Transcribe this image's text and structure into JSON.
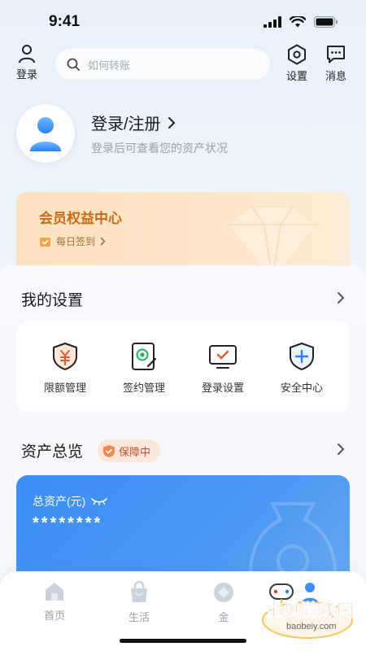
{
  "status": {
    "time": "9:41"
  },
  "nav": {
    "login_label": "登录",
    "search_placeholder": "如何转账",
    "settings_label": "设置",
    "messages_label": "消息"
  },
  "profile": {
    "title": "登录/注册",
    "subtitle": "登录后可查看您的资产状况"
  },
  "member": {
    "title": "会员权益中心",
    "checkin": "每日签到"
  },
  "settings_section": {
    "title": "我的设置",
    "items": [
      {
        "label": "限额管理",
        "icon": "yuan-shield-icon"
      },
      {
        "label": "签约管理",
        "icon": "contract-icon"
      },
      {
        "label": "登录设置",
        "icon": "monitor-check-icon"
      },
      {
        "label": "安全中心",
        "icon": "shield-plus-icon"
      }
    ]
  },
  "assets": {
    "title": "资产总览",
    "badge": "保障中",
    "total_label": "总资产(元)",
    "total_value": "********"
  },
  "tabbar": {
    "items": [
      {
        "label": "首页"
      },
      {
        "label": "生活"
      },
      {
        "label": "金"
      },
      {
        "label": ""
      }
    ]
  },
  "watermark": {
    "brand": "宝贝游戏网",
    "url": "baobeiy.com"
  },
  "colors": {
    "accent_blue": "#3d8ff5",
    "member_orange": "#c86a18",
    "badge_red": "#c5542c"
  }
}
